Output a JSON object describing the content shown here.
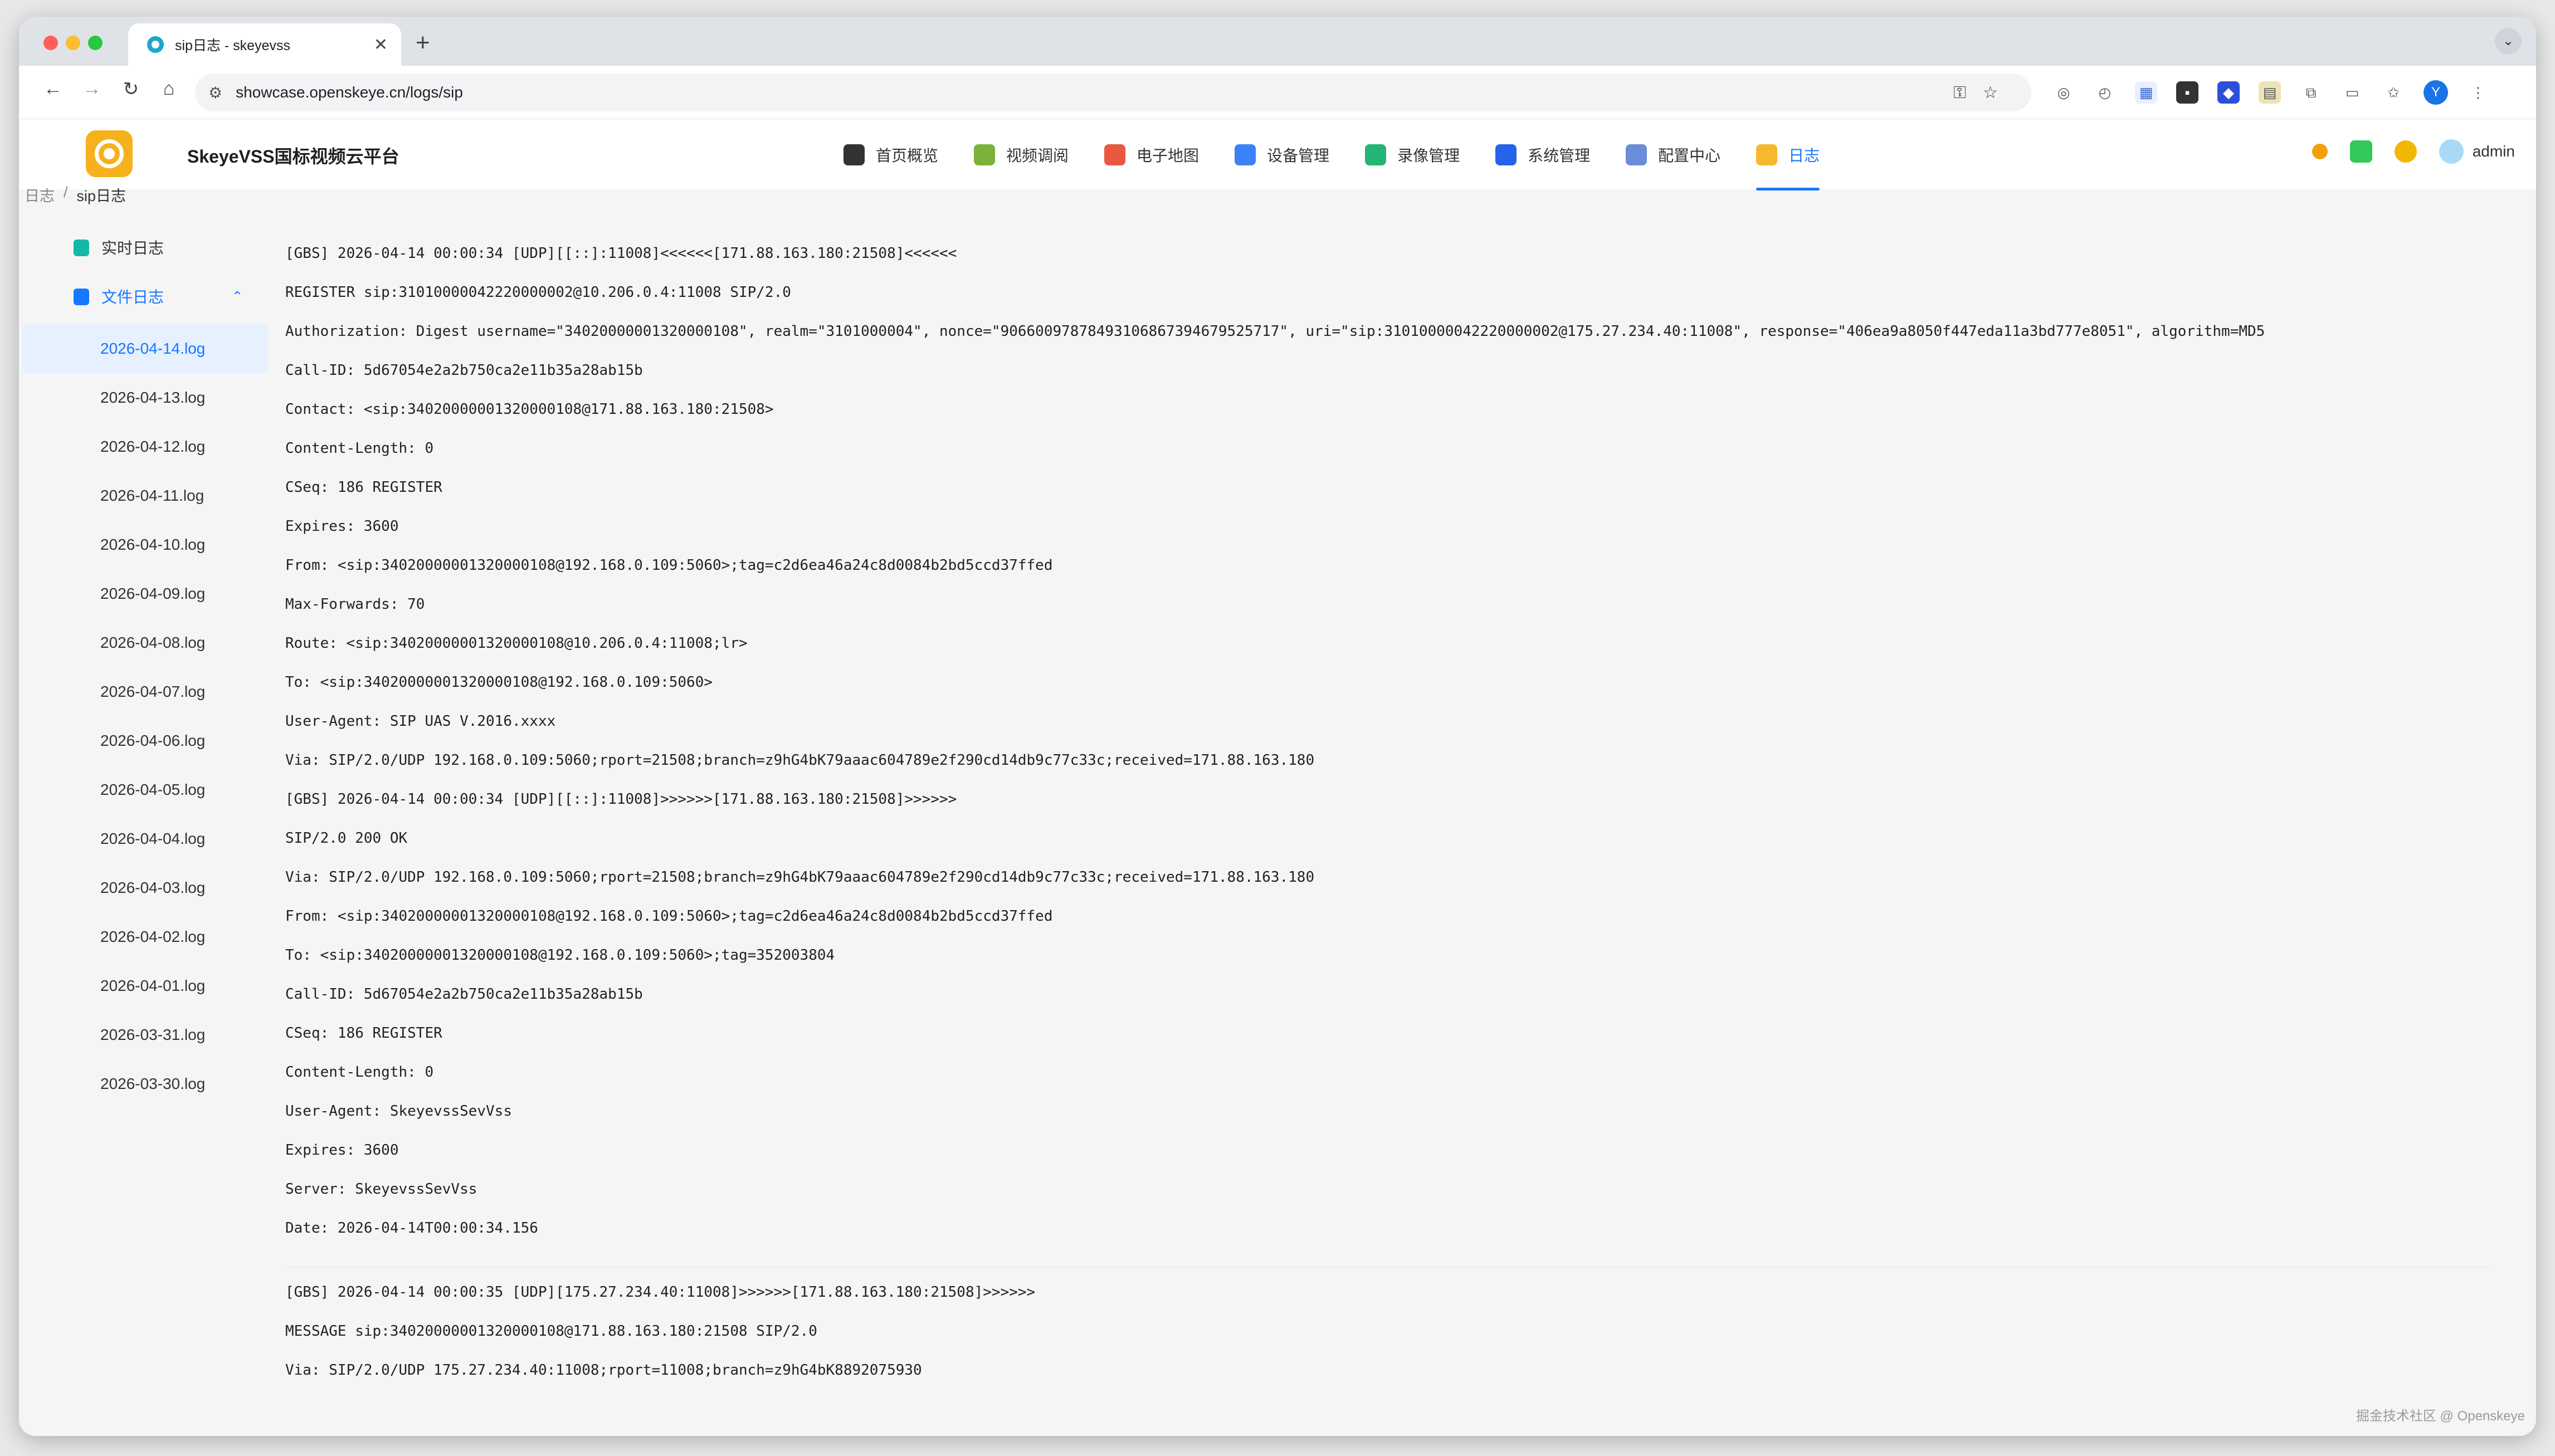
{
  "browser": {
    "tab_title": "sip日志 - skeyevss",
    "tab_close": "✕",
    "new_tab": "+",
    "url": "showcase.openskeye.cn/logs/sip",
    "profile_initial": "Y"
  },
  "app": {
    "title": "SkeyeVSS国标视频云平台",
    "nav": [
      {
        "label": "首页概览",
        "icon_color": "#333333"
      },
      {
        "label": "视频调阅",
        "icon_color": "#7bb33a"
      },
      {
        "label": "电子地图",
        "icon_color": "#e9573f"
      },
      {
        "label": "设备管理",
        "icon_color": "#3b82f6"
      },
      {
        "label": "录像管理",
        "icon_color": "#22b573"
      },
      {
        "label": "系统管理",
        "icon_color": "#2563eb"
      },
      {
        "label": "配置中心",
        "icon_color": "#6b8cd6"
      },
      {
        "label": "日志",
        "icon_color": "#f5b82e"
      }
    ],
    "user": "admin",
    "accent": "#1677ff"
  },
  "breadcrumb": {
    "root": "日志",
    "sep": "/",
    "current": "sip日志"
  },
  "sidebar": {
    "realtime": "实时日志",
    "files": "文件日志",
    "chevron": "⌃",
    "file_items": [
      "2026-04-14.log",
      "2026-04-13.log",
      "2026-04-12.log",
      "2026-04-11.log",
      "2026-04-10.log",
      "2026-04-09.log",
      "2026-04-08.log",
      "2026-04-07.log",
      "2026-04-06.log",
      "2026-04-05.log",
      "2026-04-04.log",
      "2026-04-03.log",
      "2026-04-02.log",
      "2026-04-01.log",
      "2026-03-31.log",
      "2026-03-30.log"
    ]
  },
  "log": {
    "block1": [
      "[GBS] 2026-04-14 00:00:34 [UDP][[::]:11008]<<<<<<[171.88.163.180:21508]<<<<<<",
      "REGISTER sip:31010000042220000002@10.206.0.4:11008 SIP/2.0",
      "Authorization: Digest username=\"34020000001320000108\", realm=\"3101000004\", nonce=\"90660097878493106867394679525717\", uri=\"sip:31010000042220000002@175.27.234.40:11008\", response=\"406ea9a8050f447eda11a3bd777e8051\", algorithm=MD5",
      "Call-ID: 5d67054e2a2b750ca2e11b35a28ab15b",
      "Contact: <sip:34020000001320000108@171.88.163.180:21508>",
      "Content-Length: 0",
      "CSeq: 186 REGISTER",
      "Expires: 3600",
      "From: <sip:34020000001320000108@192.168.0.109:5060>;tag=c2d6ea46a24c8d0084b2bd5ccd37ffed",
      "Max-Forwards: 70",
      "Route: <sip:34020000001320000108@10.206.0.4:11008;lr>",
      "To: <sip:34020000001320000108@192.168.0.109:5060>",
      "User-Agent: SIP UAS V.2016.xxxx",
      "Via: SIP/2.0/UDP 192.168.0.109:5060;rport=21508;branch=z9hG4bK79aaac604789e2f290cd14db9c77c33c;received=171.88.163.180",
      "[GBS] 2026-04-14 00:00:34 [UDP][[::]:11008]>>>>>>[171.88.163.180:21508]>>>>>>",
      "SIP/2.0 200 OK",
      "Via: SIP/2.0/UDP 192.168.0.109:5060;rport=21508;branch=z9hG4bK79aaac604789e2f290cd14db9c77c33c;received=171.88.163.180",
      "From: <sip:34020000001320000108@192.168.0.109:5060>;tag=c2d6ea46a24c8d0084b2bd5ccd37ffed",
      "To: <sip:34020000001320000108@192.168.0.109:5060>;tag=352003804",
      "Call-ID: 5d67054e2a2b750ca2e11b35a28ab15b",
      "CSeq: 186 REGISTER",
      "Content-Length: 0",
      "User-Agent: SkeyevssSevVss",
      "Expires: 3600",
      "Server: SkeyevssSevVss",
      "Date: 2026-04-14T00:00:34.156"
    ],
    "block2": [
      "[GBS] 2026-04-14 00:00:35 [UDP][175.27.234.40:11008]>>>>>>[171.88.163.180:21508]>>>>>>",
      "MESSAGE sip:34020000001320000108@171.88.163.180:21508 SIP/2.0",
      "Via: SIP/2.0/UDP 175.27.234.40:11008;rport=11008;branch=z9hG4bK8892075930"
    ]
  },
  "watermark": "掘金技术社区 @ Openskeye"
}
